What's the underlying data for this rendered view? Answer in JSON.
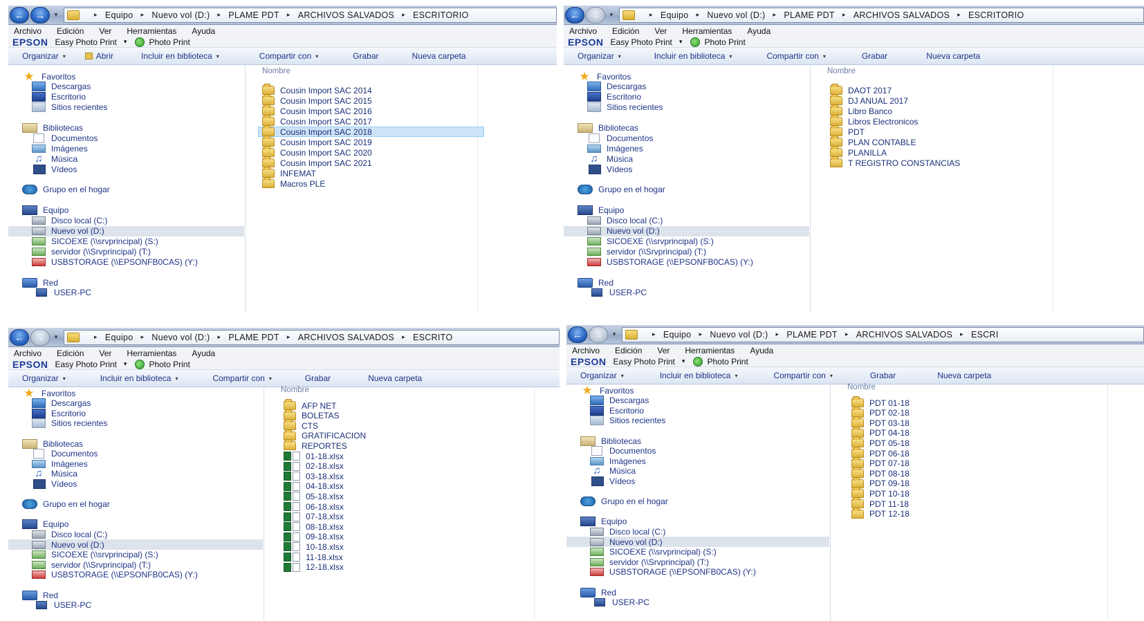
{
  "windows": [
    {
      "address": [
        "Equipo",
        "Nuevo vol (D:)",
        "PLAME PDT",
        "ARCHIVOS SALVADOS",
        "ESCRITORIO"
      ],
      "menu": [
        "Archivo",
        "Edición",
        "Ver",
        "Herramientas",
        "Ayuda"
      ],
      "epson": {
        "logo": "EPSON",
        "easy_photo_print": "Easy Photo Print",
        "photo_print": "Photo Print"
      },
      "commands": [
        "Organizar",
        "Abrir",
        "Incluir en biblioteca",
        "Compartir con",
        "Grabar",
        "Nueva carpeta"
      ],
      "column_header": "Nombre",
      "selected_file": 4,
      "files": [
        {
          "name": "Cousin Import SAC 2014",
          "type": "folder"
        },
        {
          "name": "Cousin Import SAC 2015",
          "type": "folder"
        },
        {
          "name": "Cousin Import SAC 2016",
          "type": "folder"
        },
        {
          "name": "Cousin Import SAC 2017",
          "type": "folder"
        },
        {
          "name": "Cousin Import SAC 2018",
          "type": "folder"
        },
        {
          "name": "Cousin Import SAC 2019",
          "type": "folder"
        },
        {
          "name": "Cousin Import SAC 2020",
          "type": "folder"
        },
        {
          "name": "Cousin Import SAC 2021",
          "type": "folder"
        },
        {
          "name": "INFEMAT",
          "type": "folder"
        },
        {
          "name": "Macros PLE",
          "type": "folder"
        }
      ]
    },
    {
      "address": [
        "Equipo",
        "Nuevo vol (D:)",
        "PLAME PDT",
        "ARCHIVOS SALVADOS",
        "ESCRITORIO"
      ],
      "menu": [
        "Archivo",
        "Edición",
        "Ver",
        "Herramientas",
        "Ayuda"
      ],
      "epson": {
        "logo": "EPSON",
        "easy_photo_print": "Easy Photo Print",
        "photo_print": "Photo Print"
      },
      "commands": [
        "Organizar",
        "Incluir en biblioteca",
        "Compartir con",
        "Grabar",
        "Nueva carpeta"
      ],
      "column_header": "Nombre",
      "selected_file": -1,
      "files": [
        {
          "name": "DAOT 2017",
          "type": "folder"
        },
        {
          "name": "DJ ANUAL 2017",
          "type": "folder"
        },
        {
          "name": "Libro Banco",
          "type": "folder"
        },
        {
          "name": "Libros Electronicos",
          "type": "folder"
        },
        {
          "name": "PDT",
          "type": "folder"
        },
        {
          "name": "PLAN CONTABLE",
          "type": "folder"
        },
        {
          "name": "PLANILLA",
          "type": "folder"
        },
        {
          "name": "T REGISTRO CONSTANCIAS",
          "type": "folder"
        }
      ]
    },
    {
      "address": [
        "Equipo",
        "Nuevo vol (D:)",
        "PLAME PDT",
        "ARCHIVOS SALVADOS",
        "ESCRITO"
      ],
      "menu": [
        "Archivo",
        "Edición",
        "Ver",
        "Herramientas",
        "Ayuda"
      ],
      "epson": {
        "logo": "EPSON",
        "easy_photo_print": "Easy Photo Print",
        "photo_print": "Photo Print"
      },
      "commands": [
        "Organizar",
        "Incluir en biblioteca",
        "Compartir con",
        "Grabar",
        "Nueva carpeta"
      ],
      "column_header": "Nombre",
      "selected_file": -1,
      "files": [
        {
          "name": "AFP NET",
          "type": "folder"
        },
        {
          "name": "BOLETAS",
          "type": "folder"
        },
        {
          "name": "CTS",
          "type": "folder"
        },
        {
          "name": "GRATIFICACION",
          "type": "folder"
        },
        {
          "name": "REPORTES",
          "type": "folder"
        },
        {
          "name": "01-18.xlsx",
          "type": "excel"
        },
        {
          "name": "02-18.xlsx",
          "type": "excel"
        },
        {
          "name": "03-18.xlsx",
          "type": "excel"
        },
        {
          "name": "04-18.xlsx",
          "type": "excel"
        },
        {
          "name": "05-18.xlsx",
          "type": "excel"
        },
        {
          "name": "06-18.xlsx",
          "type": "excel"
        },
        {
          "name": "07-18.xlsx",
          "type": "excel"
        },
        {
          "name": "08-18.xlsx",
          "type": "excel"
        },
        {
          "name": "09-18.xlsx",
          "type": "excel"
        },
        {
          "name": "10-18.xlsx",
          "type": "excel"
        },
        {
          "name": "11-18.xlsx",
          "type": "excel"
        },
        {
          "name": "12-18.xlsx",
          "type": "excel"
        }
      ]
    },
    {
      "address": [
        "Equipo",
        "Nuevo vol (D:)",
        "PLAME PDT",
        "ARCHIVOS SALVADOS",
        "ESCRI"
      ],
      "menu": [
        "Archivo",
        "Edición",
        "Ver",
        "Herramientas",
        "Ayuda"
      ],
      "epson": {
        "logo": "EPSON",
        "easy_photo_print": "Easy Photo Print",
        "photo_print": "Photo Print"
      },
      "commands": [
        "Organizar",
        "Incluir en biblioteca",
        "Compartir con",
        "Grabar",
        "Nueva carpeta"
      ],
      "column_header": "Nombre",
      "selected_file": -1,
      "files": [
        {
          "name": "PDT 01-18",
          "type": "folder"
        },
        {
          "name": "PDT 02-18",
          "type": "folder"
        },
        {
          "name": "PDT 03-18",
          "type": "folder"
        },
        {
          "name": "PDT 04-18",
          "type": "folder"
        },
        {
          "name": "PDT 05-18",
          "type": "folder"
        },
        {
          "name": "PDT 06-18",
          "type": "folder"
        },
        {
          "name": "PDT 07-18",
          "type": "folder"
        },
        {
          "name": "PDT 08-18",
          "type": "folder"
        },
        {
          "name": "PDT 09-18",
          "type": "folder"
        },
        {
          "name": "PDT 10-18",
          "type": "folder"
        },
        {
          "name": "PDT 11-18",
          "type": "folder"
        },
        {
          "name": "PDT 12-18",
          "type": "folder"
        }
      ]
    }
  ],
  "nav_tree": [
    {
      "label": "Favoritos",
      "icon": "star-icon",
      "level": 0,
      "gap": 0
    },
    {
      "label": "Descargas",
      "icon": "dl-icon",
      "level": 1,
      "gap": 0
    },
    {
      "label": "Escritorio",
      "icon": "desk-icon",
      "level": 1,
      "gap": 0
    },
    {
      "label": "Sitios recientes",
      "icon": "recent-icon",
      "level": 1,
      "gap": 0
    },
    {
      "label": "Bibliotecas",
      "icon": "lib-icon",
      "level": 0,
      "gap": 1
    },
    {
      "label": "Documentos",
      "icon": "doc-icon",
      "level": 1,
      "gap": 0
    },
    {
      "label": "Imágenes",
      "icon": "img-icon",
      "level": 1,
      "gap": 0
    },
    {
      "label": "Música",
      "icon": "music-icon",
      "level": 1,
      "gap": 0
    },
    {
      "label": "Vídeos",
      "icon": "video-icon",
      "level": 1,
      "gap": 0
    },
    {
      "label": "Grupo en el hogar",
      "icon": "home-icon",
      "level": 0,
      "gap": 1
    },
    {
      "label": "Equipo",
      "icon": "pc-icon",
      "level": 0,
      "gap": 1
    },
    {
      "label": "Disco local (C:)",
      "icon": "hdd-icon",
      "level": 1,
      "gap": 0
    },
    {
      "label": "Nuevo vol (D:)",
      "icon": "hdd-icon",
      "level": 1,
      "gap": 0,
      "selected": true
    },
    {
      "label": "SICOEXE (\\\\srvprincipal) (S:)",
      "icon": "netdrive-icon",
      "level": 1,
      "gap": 0
    },
    {
      "label": "servidor (\\\\Srvprincipal) (T:)",
      "icon": "netdrive-icon",
      "level": 1,
      "gap": 0
    },
    {
      "label": "USBSTORAGE (\\\\EPSONFB0CAS) (Y:)",
      "icon": "usb-icon",
      "level": 1,
      "gap": 0
    },
    {
      "label": "Red",
      "icon": "net-icon",
      "level": 0,
      "gap": 1
    },
    {
      "label": "USER-PC",
      "icon": "userpc-icon",
      "level": 1,
      "gap": 0
    }
  ],
  "icons": {
    "back": "back-arrow-icon",
    "forward": "forward-arrow-icon",
    "dropdown": "chevron-down-icon",
    "breadcrumb_sep": "breadcrumb-arrow-icon"
  }
}
